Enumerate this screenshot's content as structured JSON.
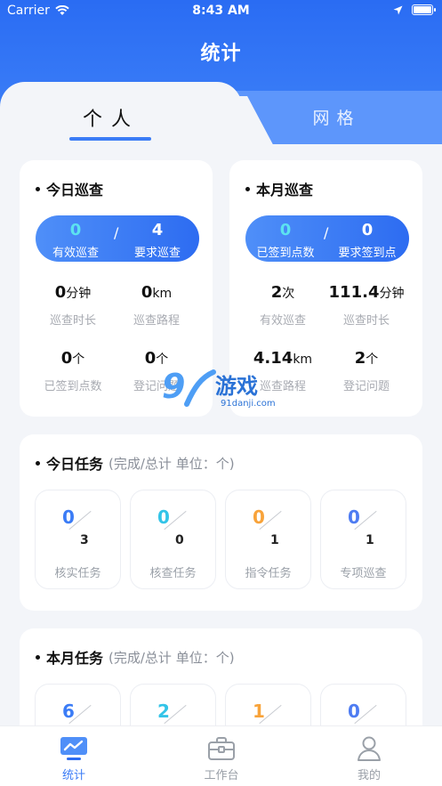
{
  "status_bar": {
    "carrier": "Carrier",
    "time": "8:43 AM"
  },
  "header": {
    "title": "统计"
  },
  "tabs": {
    "personal": "个人",
    "grid": "网格"
  },
  "today_patrol": {
    "title": "今日巡查",
    "pill": {
      "done": "0",
      "done_label": "有效巡查",
      "slash": "/",
      "required": "4",
      "required_label": "要求巡查"
    },
    "stats": [
      {
        "value": "0",
        "unit": "分钟",
        "label": "巡查时长"
      },
      {
        "value": "0",
        "unit": "km",
        "label": "巡查路程"
      },
      {
        "value": "0",
        "unit": "个",
        "label": "已签到点数"
      },
      {
        "value": "0",
        "unit": "个",
        "label": "登记问题"
      }
    ]
  },
  "month_patrol": {
    "title": "本月巡查",
    "pill": {
      "done": "0",
      "done_label": "已签到点数",
      "slash": "/",
      "required": "0",
      "required_label": "要求签到点"
    },
    "stats": [
      {
        "value": "2",
        "unit": "次",
        "label": "有效巡查"
      },
      {
        "value": "111.4",
        "unit": "分钟",
        "label": "巡查时长"
      },
      {
        "value": "4.14",
        "unit": "km",
        "label": "巡查路程"
      },
      {
        "value": "2",
        "unit": "个",
        "label": "登记问题"
      }
    ]
  },
  "today_tasks": {
    "title": "今日任务",
    "subtitle": "(完成/总计 单位：个)",
    "items": [
      {
        "done": "0",
        "total": "3",
        "label": "核实任务",
        "color": "#3b7cf6"
      },
      {
        "done": "0",
        "total": "0",
        "label": "核查任务",
        "color": "#33c4e8"
      },
      {
        "done": "0",
        "total": "1",
        "label": "指令任务",
        "color": "#f8a33a"
      },
      {
        "done": "0",
        "total": "1",
        "label": "专项巡查",
        "color": "#4e7cf2"
      }
    ]
  },
  "month_tasks": {
    "title": "本月任务",
    "subtitle": "(完成/总计 单位：个)",
    "items": [
      {
        "done": "6"
      },
      {
        "done": "2"
      },
      {
        "done": "1"
      },
      {
        "done": "0"
      }
    ]
  },
  "watermark": {
    "logo": "9",
    "name": "游戏",
    "url": "91danji.com"
  },
  "bottom_nav": [
    {
      "label": "统计",
      "icon": "chart-icon"
    },
    {
      "label": "工作台",
      "icon": "briefcase-icon"
    },
    {
      "label": "我的",
      "icon": "user-icon"
    }
  ]
}
